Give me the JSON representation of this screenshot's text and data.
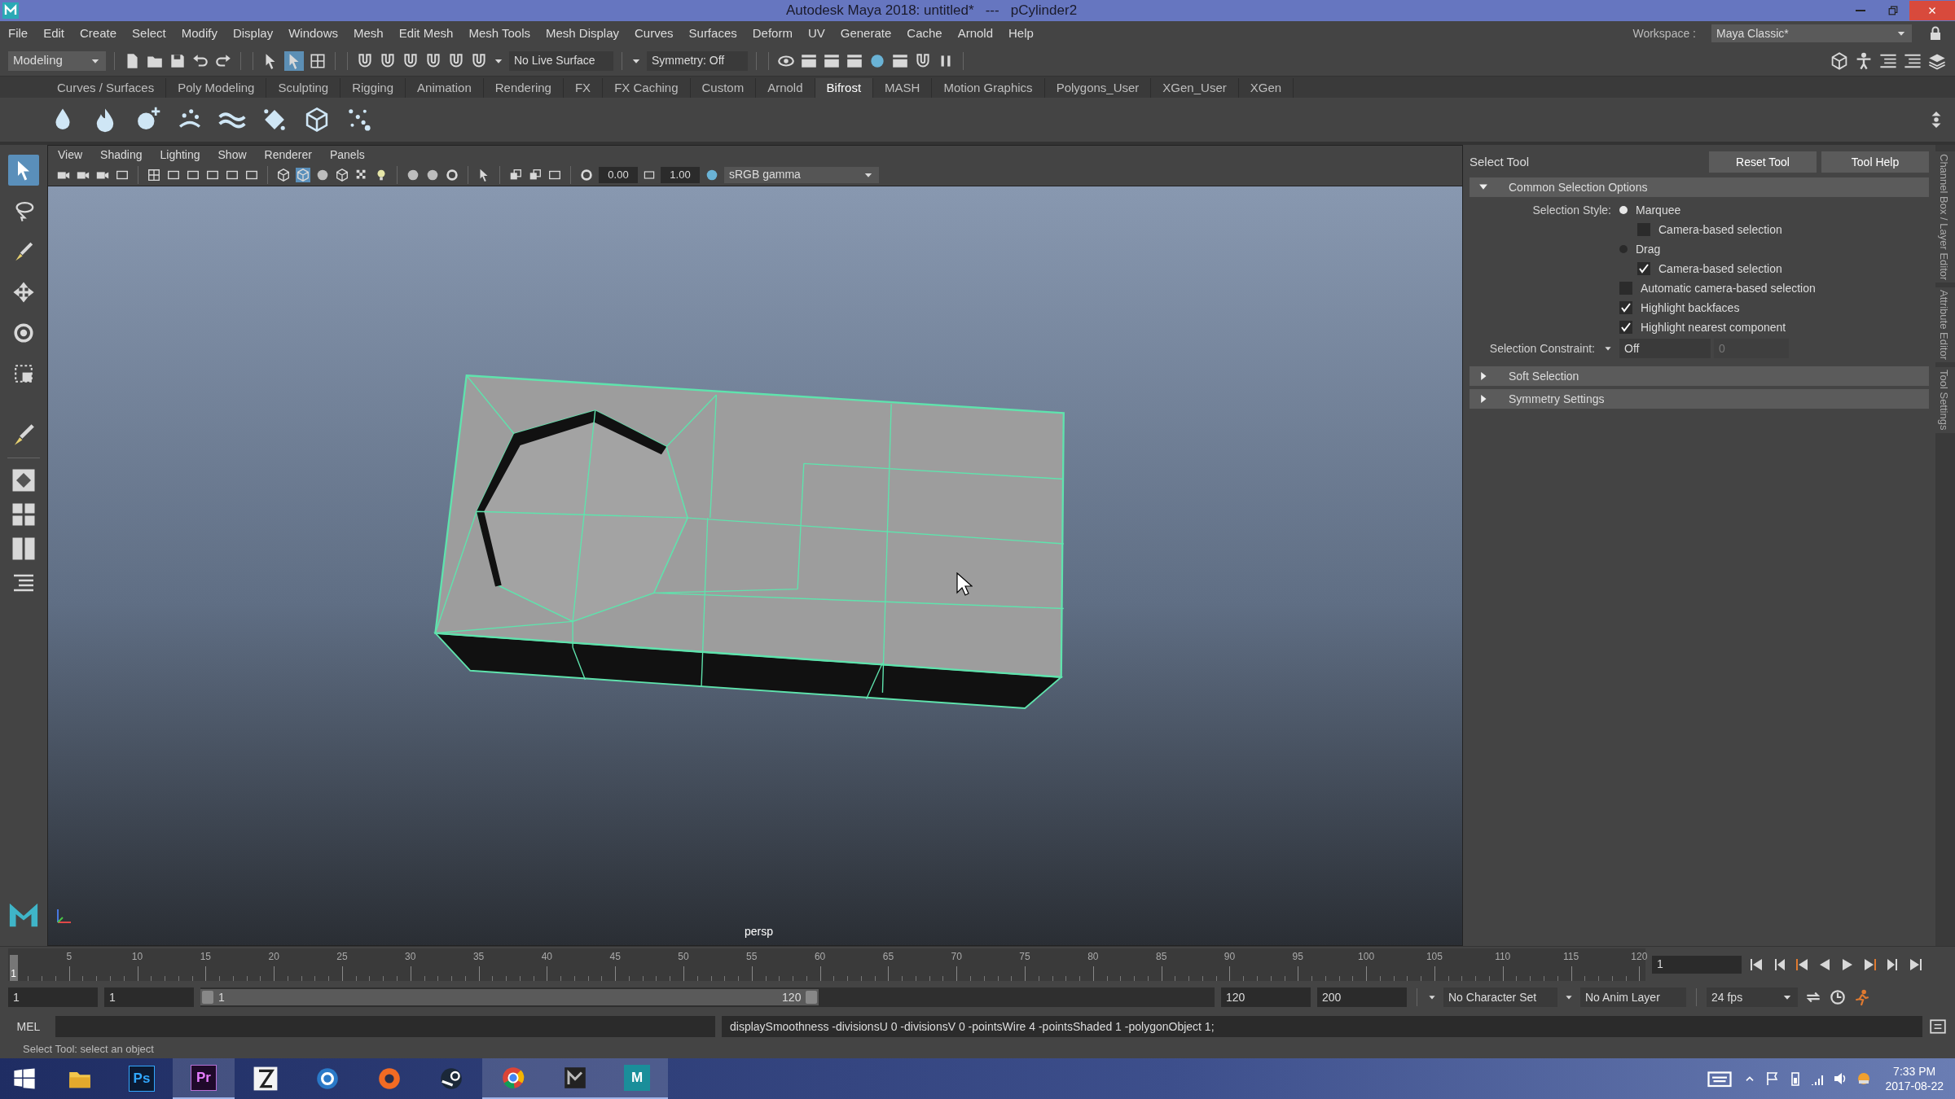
{
  "window": {
    "title": "Autodesk Maya 2018: untitled*   ---   pCylinder2"
  },
  "menu_bar": [
    "File",
    "Edit",
    "Create",
    "Select",
    "Modify",
    "Display",
    "Windows",
    "Mesh",
    "Edit Mesh",
    "Mesh Tools",
    "Mesh Display",
    "Curves",
    "Surfaces",
    "Deform",
    "UV",
    "Generate",
    "Cache",
    "Arnold",
    "Help"
  ],
  "status_line": {
    "mode": "Modeling",
    "live_surface": "No Live Surface",
    "symmetry": "Symmetry: Off",
    "workspace_label": "Workspace :",
    "workspace": "Maya Classic*"
  },
  "shelf": {
    "tabs": [
      {
        "label": "Curves / Surfaces",
        "selected": false
      },
      {
        "label": "Poly Modeling",
        "selected": false
      },
      {
        "label": "Sculpting",
        "selected": false
      },
      {
        "label": "Rigging",
        "selected": false
      },
      {
        "label": "Animation",
        "selected": false
      },
      {
        "label": "Rendering",
        "selected": false
      },
      {
        "label": "FX",
        "selected": false
      },
      {
        "label": "FX Caching",
        "selected": false
      },
      {
        "label": "Custom",
        "selected": false
      },
      {
        "label": "Arnold",
        "selected": false
      },
      {
        "label": "Bifrost",
        "selected": true
      },
      {
        "label": "MASH",
        "selected": false
      },
      {
        "label": "Motion Graphics",
        "selected": false
      },
      {
        "label": "Polygons_User",
        "selected": false
      },
      {
        "label": "XGen_User",
        "selected": false
      },
      {
        "label": "XGen",
        "selected": false
      }
    ]
  },
  "toolbox": [
    {
      "kind": "select",
      "selected": true
    },
    {
      "kind": "lasso",
      "selected": false
    },
    {
      "kind": "paint",
      "selected": false
    },
    {
      "kind": "move",
      "selected": false
    },
    {
      "kind": "rotate",
      "selected": false
    },
    {
      "kind": "scale",
      "selected": false
    }
  ],
  "viewport": {
    "menus": [
      "View",
      "Shading",
      "Lighting",
      "Show",
      "Renderer",
      "Panels"
    ],
    "exposure": "0.00",
    "gamma": "1.00",
    "color_space": "sRGB gamma",
    "camera": "persp"
  },
  "tool_settings": {
    "title": "Select Tool",
    "buttons": [
      "Reset Tool",
      "Tool Help"
    ],
    "sections": [
      {
        "label": "Common Selection Options",
        "expanded": true
      },
      {
        "label": "Soft Selection",
        "expanded": false
      },
      {
        "label": "Symmetry Settings",
        "expanded": false
      }
    ],
    "selection_style_label": "Selection Style:",
    "options": [
      {
        "kind": "radio",
        "label": "Marquee",
        "selected": true
      },
      {
        "kind": "subcheckbox",
        "label": "Camera-based selection",
        "checked": false
      },
      {
        "kind": "radio",
        "label": "Drag",
        "selected": false
      },
      {
        "kind": "subcheckbox",
        "label": "Camera-based selection",
        "checked": true
      },
      {
        "kind": "checkbox",
        "label": "Automatic camera-based selection",
        "checked": false
      },
      {
        "kind": "checkbox",
        "label": "Highlight backfaces",
        "checked": true
      },
      {
        "kind": "checkbox",
        "label": "Highlight nearest component",
        "checked": true
      }
    ],
    "constraint": {
      "label": "Selection Constraint:",
      "value": "Off",
      "count": "0"
    }
  },
  "side_tabs": [
    "Channel Box / Layer Editor",
    "Attribute Editor",
    "Tool Settings"
  ],
  "timeline": {
    "current_frame": "1",
    "ticks": [
      "5",
      "10",
      "15",
      "20",
      "25",
      "30",
      "35",
      "40",
      "45",
      "50",
      "55",
      "60",
      "65",
      "70",
      "75",
      "80",
      "85",
      "90",
      "95",
      "100",
      "105",
      "110",
      "115",
      "120"
    ],
    "frame_field": "1"
  },
  "range": {
    "level": 0.61,
    "start": "1",
    "playback_start": "1",
    "slider_start": "1",
    "slider_end": "120",
    "playback_end": "120",
    "end": "200",
    "character_set": "No Character Set",
    "anim_layer": "No Anim Layer",
    "fps": "24 fps"
  },
  "command_line": {
    "label": "MEL",
    "output": "displaySmoothness -divisionsU 0 -divisionsV 0 -pointsWire 4 -pointsShaded 1 -polygonObject 1;"
  },
  "help_line": "Select Tool: select an object",
  "taskbar": {
    "apps": [
      {
        "kind": "folder",
        "running": false
      },
      {
        "kind": "photoshop",
        "label": "Ps",
        "running": false
      },
      {
        "kind": "premiere",
        "label": "Pr",
        "running": true
      },
      {
        "kind": "figure",
        "running": false
      },
      {
        "kind": "ring",
        "running": false
      },
      {
        "kind": "orange",
        "running": false
      },
      {
        "kind": "steam",
        "running": false
      },
      {
        "kind": "chrome",
        "running": true
      },
      {
        "kind": "dark",
        "running": true
      },
      {
        "kind": "maya",
        "label": "M",
        "running": true
      }
    ],
    "time": "7:33 PM",
    "date": "2017-08-22"
  }
}
